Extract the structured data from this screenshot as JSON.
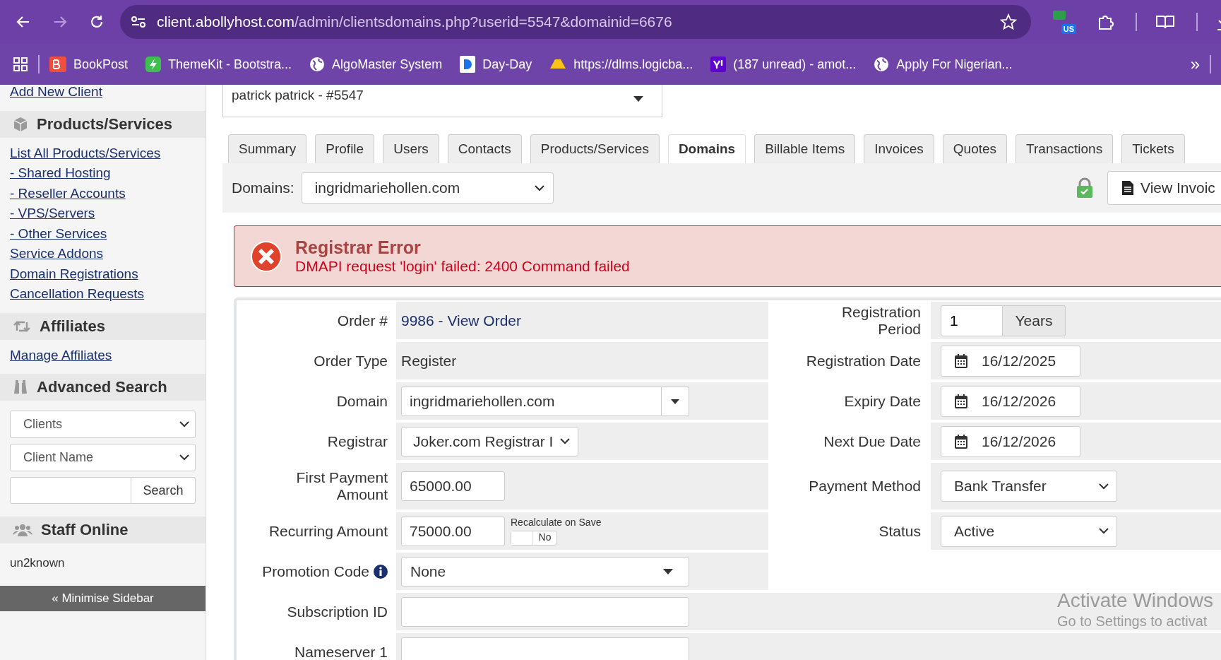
{
  "browser": {
    "url_host": "client.abollyhost.com",
    "url_path": "/admin/clientsdomains.php?userid=5547&domainid=6676",
    "profile_badge": "US",
    "bookmarks": [
      {
        "label": "BookPost",
        "kind": "bp"
      },
      {
        "label": "ThemeKit - Bootstra...",
        "kind": "tk"
      },
      {
        "label": "AlgoMaster System",
        "kind": "globe"
      },
      {
        "label": "Day-Day",
        "kind": "d"
      },
      {
        "label": "https://dlms.logicba...",
        "kind": "drive"
      },
      {
        "label": "(187 unread) - amot...",
        "kind": "yahoo"
      },
      {
        "label": "Apply For Nigerian...",
        "kind": "globe"
      }
    ],
    "more": "»"
  },
  "sidebar": {
    "top_link": "Add New Client",
    "sections": [
      {
        "title": "Products/Services",
        "kind": "links",
        "links": [
          "List All Products/Services",
          "- Shared Hosting",
          "- Reseller Accounts",
          "- VPS/Servers",
          "- Other Services",
          "Service Addons",
          "Domain Registrations",
          "Cancellation Requests"
        ]
      },
      {
        "title": "Affiliates",
        "kind": "links",
        "links": [
          "Manage Affiliates"
        ]
      },
      {
        "title": "Advanced Search",
        "kind": "search",
        "selects": [
          "Clients",
          "Client Name"
        ],
        "button": "Search"
      },
      {
        "title": "Staff Online",
        "kind": "staff",
        "names": [
          "un2known"
        ]
      }
    ],
    "minimise": "« Minimise Sidebar"
  },
  "client_select": "patrick patrick - #5547",
  "tabs": [
    {
      "label": "Summary",
      "selected": false
    },
    {
      "label": "Profile",
      "selected": false
    },
    {
      "label": "Users",
      "selected": false
    },
    {
      "label": "Contacts",
      "selected": false
    },
    {
      "label": "Products/Services",
      "selected": false
    },
    {
      "label": "Domains",
      "selected": true
    },
    {
      "label": "Billable Items",
      "selected": false
    },
    {
      "label": "Invoices",
      "selected": false
    },
    {
      "label": "Quotes",
      "selected": false
    },
    {
      "label": "Transactions",
      "selected": false
    },
    {
      "label": "Tickets",
      "selected": false
    }
  ],
  "toolbar": {
    "label": "Domains:",
    "domain": "ingridmariehollen.com",
    "button": "View Invoic"
  },
  "error": {
    "title": "Registrar Error",
    "message": "DMAPI request 'login' failed: 2400 Command failed"
  },
  "form": {
    "left": [
      {
        "label": "Order #",
        "kind": "link",
        "value": "9986 - View Order"
      },
      {
        "label": "Order Type",
        "kind": "text",
        "value": "Register"
      },
      {
        "label": "Domain",
        "kind": "combo",
        "value": "ingridmariehollen.com"
      },
      {
        "label": "Registrar",
        "kind": "select",
        "value": "Joker.com Registrar I"
      },
      {
        "label": "First Payment Amount",
        "kind": "input",
        "value": "65000.00"
      },
      {
        "label": "Recurring Amount",
        "kind": "input_toggle",
        "value": "75000.00",
        "toggle_label": "Recalculate on Save",
        "toggle_text": "No",
        "on": false
      },
      {
        "label": "Promotion Code",
        "kind": "dropdown",
        "value": "None",
        "info": true
      },
      {
        "label": "Subscription ID",
        "kind": "wide_input"
      },
      {
        "label": "Nameserver 1",
        "kind": "wide_input"
      }
    ],
    "right": [
      {
        "label": "Registration Period",
        "kind": "period",
        "value": "1",
        "unit": "Years"
      },
      {
        "label": "Registration Date",
        "kind": "date",
        "value": "16/12/2025"
      },
      {
        "label": "Expiry Date",
        "kind": "date",
        "value": "16/12/2026"
      },
      {
        "label": "Next Due Date",
        "kind": "date",
        "value": "16/12/2026"
      },
      {
        "label": "Payment Method",
        "kind": "select",
        "value": "Bank Transfer"
      },
      {
        "label": "Status",
        "kind": "select",
        "value": "Active"
      }
    ]
  },
  "os_overlay": {
    "title": "Activate Windows",
    "subtitle": "Go to Settings to activat"
  }
}
